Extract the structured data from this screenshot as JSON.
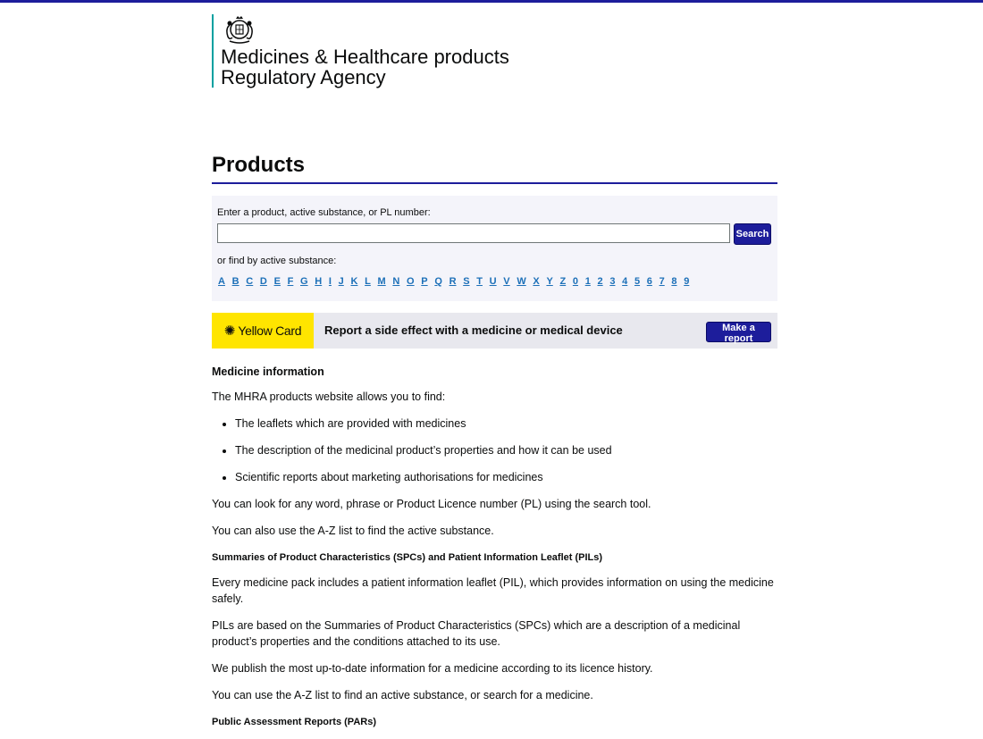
{
  "header": {
    "logo_line1": "Medicines & Healthcare products",
    "logo_line2": "Regulatory Agency",
    "crest_icon": "royal-coat-of-arms-icon"
  },
  "page_title": "Products",
  "search": {
    "label": "Enter a product, active substance, or PL number:",
    "value": "",
    "placeholder": "",
    "button_label": "Search",
    "az_label": "or find by active substance:",
    "az_links": [
      "A",
      "B",
      "C",
      "D",
      "E",
      "F",
      "G",
      "H",
      "I",
      "J",
      "K",
      "L",
      "M",
      "N",
      "O",
      "P",
      "Q",
      "R",
      "S",
      "T",
      "U",
      "V",
      "W",
      "X",
      "Y",
      "Z",
      "0",
      "1",
      "2",
      "3",
      "4",
      "5",
      "6",
      "7",
      "8",
      "9"
    ]
  },
  "yellow_card": {
    "logo_text": "Yellow Card",
    "message": "Report a side effect with a medicine or medical device",
    "button_label": "Make a report"
  },
  "content": {
    "heading1": "Medicine information",
    "intro": "The MHRA products website allows you to find:",
    "bullets": [
      "The leaflets which are provided with medicines",
      "The description of the medicinal product’s properties and how it can be used",
      "Scientific reports about marketing authorisations for medicines"
    ],
    "para_search": "You can look for any word, phrase or Product Licence number (PL) using the search tool.",
    "para_az": "You can also use the A-Z list to find the active substance.",
    "heading2": "Summaries of Product Characteristics (SPCs) and Patient Information Leaflet (PILs)",
    "para_pil": "Every medicine pack includes a patient information leaflet (PIL), which provides information on using the medicine safely.",
    "para_spc": "PILs are based on the Summaries of Product Characteristics (SPCs) which are a description of a medicinal product’s properties and the conditions attached to its use.",
    "para_publish": "We publish the most up-to-date information for a medicine according to its licence history.",
    "para_az2": "You can use the A-Z list to find an active substance, or search for a medicine.",
    "heading3": "Public Assessment Reports (PARs)"
  },
  "colors": {
    "brand_blue": "#1d1d9b",
    "link_blue": "#1d70b8",
    "yellow_card": "#ffe500",
    "logo_rule": "#00a0a0"
  }
}
